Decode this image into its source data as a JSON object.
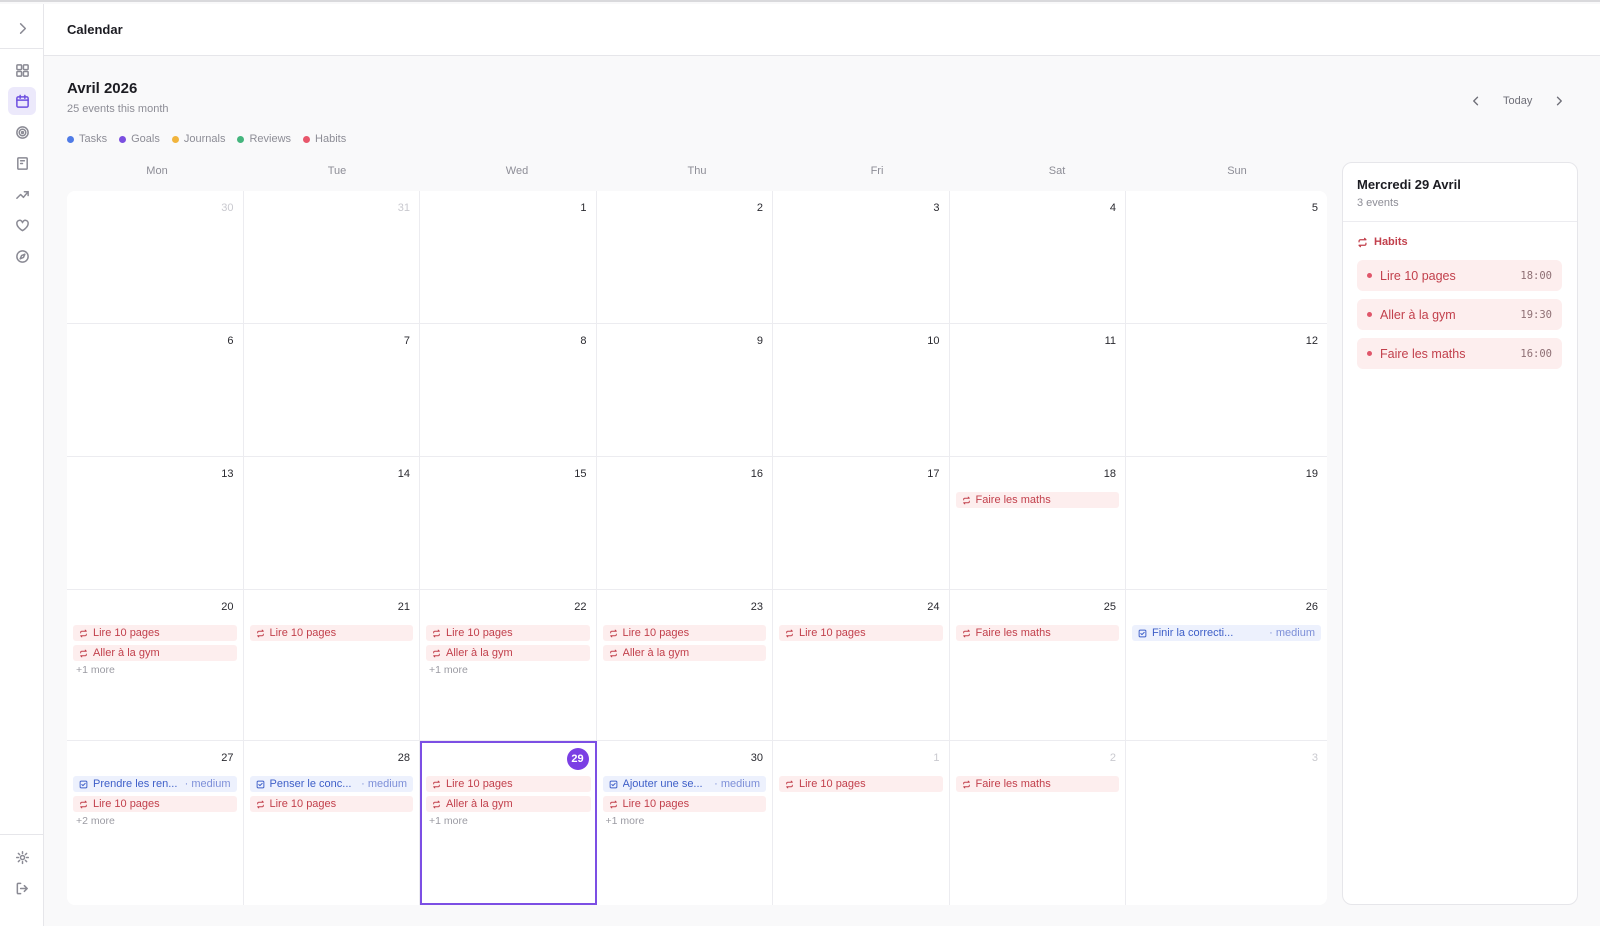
{
  "header": {
    "title": "Calendar"
  },
  "month": {
    "title": "Avril 2026",
    "subtitle": "25 events this month"
  },
  "legend": [
    {
      "label": "Tasks",
      "color": "#4f7be6"
    },
    {
      "label": "Goals",
      "color": "#7b4fe0"
    },
    {
      "label": "Journals",
      "color": "#f1b43c"
    },
    {
      "label": "Reviews",
      "color": "#44b57d"
    },
    {
      "label": "Habits",
      "color": "#e8566b"
    }
  ],
  "nav": {
    "today_label": "Today"
  },
  "weekdays": [
    "Mon",
    "Tue",
    "Wed",
    "Thu",
    "Fri",
    "Sat",
    "Sun"
  ],
  "weeks": [
    [
      {
        "day": "30",
        "muted": true,
        "events": []
      },
      {
        "day": "31",
        "muted": true,
        "events": []
      },
      {
        "day": "1",
        "events": []
      },
      {
        "day": "2",
        "events": []
      },
      {
        "day": "3",
        "events": []
      },
      {
        "day": "4",
        "events": []
      },
      {
        "day": "5",
        "events": []
      }
    ],
    [
      {
        "day": "6",
        "events": []
      },
      {
        "day": "7",
        "events": []
      },
      {
        "day": "8",
        "events": []
      },
      {
        "day": "9",
        "events": []
      },
      {
        "day": "10",
        "events": []
      },
      {
        "day": "11",
        "events": []
      },
      {
        "day": "12",
        "events": []
      }
    ],
    [
      {
        "day": "13",
        "events": []
      },
      {
        "day": "14",
        "events": []
      },
      {
        "day": "15",
        "events": []
      },
      {
        "day": "16",
        "events": []
      },
      {
        "day": "17",
        "events": []
      },
      {
        "day": "18",
        "events": [
          {
            "kind": "habit",
            "label": "Faire les maths"
          }
        ]
      },
      {
        "day": "19",
        "events": []
      }
    ],
    [
      {
        "day": "20",
        "events": [
          {
            "kind": "habit",
            "label": "Lire 10 pages"
          },
          {
            "kind": "habit",
            "label": "Aller à la gym"
          }
        ],
        "more": "+1 more"
      },
      {
        "day": "21",
        "events": [
          {
            "kind": "habit",
            "label": "Lire 10 pages"
          }
        ]
      },
      {
        "day": "22",
        "events": [
          {
            "kind": "habit",
            "label": "Lire 10 pages"
          },
          {
            "kind": "habit",
            "label": "Aller à la gym"
          }
        ],
        "more": "+1 more"
      },
      {
        "day": "23",
        "events": [
          {
            "kind": "habit",
            "label": "Lire 10 pages"
          },
          {
            "kind": "habit",
            "label": "Aller à la gym"
          }
        ]
      },
      {
        "day": "24",
        "events": [
          {
            "kind": "habit",
            "label": "Lire 10 pages"
          }
        ]
      },
      {
        "day": "25",
        "events": [
          {
            "kind": "habit",
            "label": "Faire les maths"
          }
        ]
      },
      {
        "day": "26",
        "events": [
          {
            "kind": "task",
            "label": "Finir la correcti...",
            "priority": "· medium"
          }
        ]
      }
    ],
    [
      {
        "day": "27",
        "events": [
          {
            "kind": "task",
            "label": "Prendre les ren...",
            "priority": "· medium"
          },
          {
            "kind": "habit",
            "label": "Lire 10 pages"
          }
        ],
        "more": "+2 more"
      },
      {
        "day": "28",
        "events": [
          {
            "kind": "task",
            "label": "Penser le conc...",
            "priority": "· medium"
          },
          {
            "kind": "habit",
            "label": "Lire 10 pages"
          }
        ]
      },
      {
        "day": "29",
        "today": true,
        "events": [
          {
            "kind": "habit",
            "label": "Lire 10 pages"
          },
          {
            "kind": "habit",
            "label": "Aller à la gym"
          }
        ],
        "more": "+1 more"
      },
      {
        "day": "30",
        "events": [
          {
            "kind": "task",
            "label": "Ajouter une se...",
            "priority": "· medium"
          },
          {
            "kind": "habit",
            "label": "Lire 10 pages"
          }
        ],
        "more": "+1 more"
      },
      {
        "day": "1",
        "muted": true,
        "events": [
          {
            "kind": "habit",
            "label": "Lire 10 pages"
          }
        ]
      },
      {
        "day": "2",
        "muted": true,
        "events": [
          {
            "kind": "habit",
            "label": "Faire les maths"
          }
        ]
      },
      {
        "day": "3",
        "muted": true,
        "events": []
      }
    ]
  ],
  "panel": {
    "title": "Mercredi 29 Avril",
    "subtitle": "3 events",
    "group_label": "Habits",
    "items": [
      {
        "name": "Lire 10 pages",
        "time": "18:00"
      },
      {
        "name": "Aller à la gym",
        "time": "19:30"
      },
      {
        "name": "Faire les maths",
        "time": "16:00"
      }
    ]
  },
  "sidebar": {
    "icons": [
      "chevron-right-icon",
      "dashboard-icon",
      "calendar-icon",
      "target-icon",
      "journal-icon",
      "trending-icon",
      "heart-icon",
      "compass-icon",
      "settings-icon",
      "logout-icon"
    ],
    "active": "calendar-icon"
  }
}
